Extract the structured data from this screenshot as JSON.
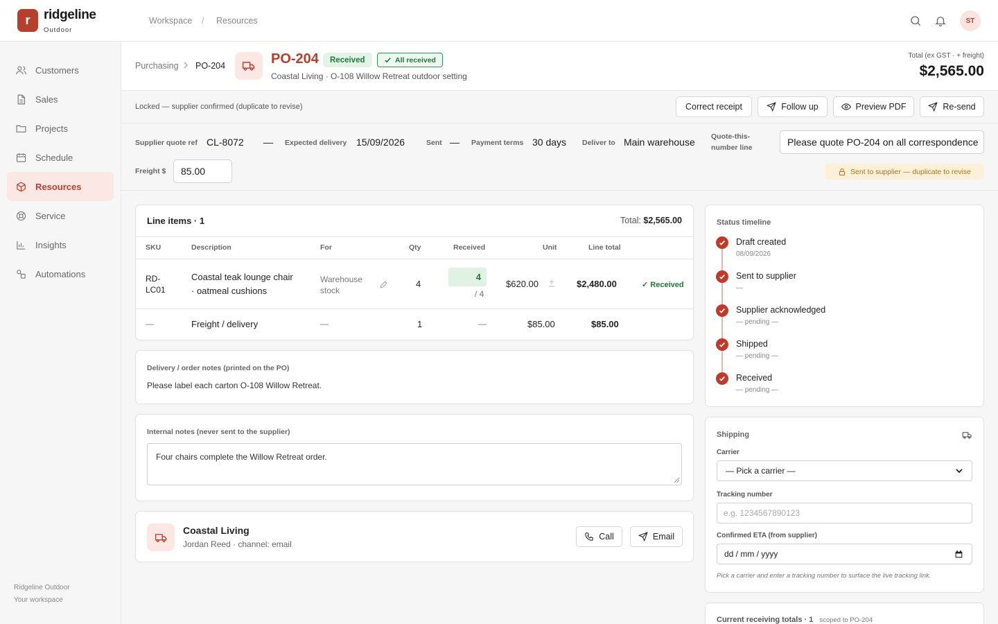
{
  "brand": {
    "initial": "r",
    "name": "ridgeline",
    "sub": "Outdoor"
  },
  "top_breadcrumb": {
    "workspace": "Workspace",
    "sep": "/",
    "resources": "Resources"
  },
  "user": {
    "initials": "ST"
  },
  "sidebar": {
    "items": [
      {
        "label": "Customers",
        "icon": "users-icon"
      },
      {
        "label": "Sales",
        "icon": "document-icon"
      },
      {
        "label": "Projects",
        "icon": "folder-icon"
      },
      {
        "label": "Schedule",
        "icon": "calendar-icon"
      },
      {
        "label": "Resources",
        "icon": "box-icon",
        "active": true
      },
      {
        "label": "Service",
        "icon": "lifebuoy-icon"
      },
      {
        "label": "Insights",
        "icon": "bar-chart-icon"
      },
      {
        "label": "Automations",
        "icon": "shapes-icon"
      }
    ],
    "footer": {
      "org": "Ridgeline Outdoor",
      "workspace": "Your workspace"
    }
  },
  "header": {
    "crumb_parent": "Purchasing",
    "crumb_current": "PO-204",
    "po_number": "PO-204",
    "status_badge": "Received",
    "received_badge": "All received",
    "subtitle": "Coastal Living · O-108 Willow Retreat outdoor setting",
    "total_label": "Total (ex GST · + freight)",
    "total_value": "$2,565.00"
  },
  "actions": {
    "locked_text": "Locked — supplier confirmed (duplicate to revise)",
    "correct_receipt": "Correct receipt",
    "follow_up": "Follow up",
    "preview_pdf": "Preview PDF",
    "resend": "Re-send"
  },
  "fields": {
    "supplier_quote_ref_label": "Supplier quote ref",
    "supplier_quote_ref": "CL-8072",
    "dash": "—",
    "expected_delivery_label": "Expected delivery",
    "expected_delivery": "15/09/2026",
    "sent_label": "Sent",
    "sent_value": "—",
    "payment_terms_label": "Payment terms",
    "payment_terms": "30 days",
    "deliver_to_label": "Deliver to",
    "deliver_to": "Main warehouse",
    "quote_line_label_1": "Quote-this-",
    "quote_line_label_2": "number line",
    "quote_line_value": "Please quote PO-204 on all correspondence",
    "freight_label": "Freight $",
    "freight_value": "85.00",
    "warning": "Sent to supplier — duplicate to revise"
  },
  "line_items": {
    "title": "Line items · 1",
    "total_label": "Total:",
    "total_value": "$2,565.00",
    "columns": {
      "sku": "SKU",
      "description": "Description",
      "for": "For",
      "qty": "Qty",
      "received": "Received",
      "unit": "Unit",
      "line_total": "Line total"
    },
    "rows": [
      {
        "sku_1": "RD-",
        "sku_2": "LC01",
        "desc_1": "Coastal teak lounge chair",
        "desc_2": "· oatmeal cushions",
        "for_1": "Warehouse",
        "for_2": "stock",
        "qty": "4",
        "received": "4",
        "received_of": "/ 4",
        "unit": "$620.00",
        "line_total": "$2,480.00",
        "status": "✓ Received"
      },
      {
        "sku": "—",
        "desc": "Freight / delivery",
        "for": "—",
        "qty": "1",
        "received": "—",
        "unit": "$85.00",
        "line_total": "$85.00"
      }
    ]
  },
  "delivery_notes": {
    "title": "Delivery / order notes (printed on the PO)",
    "text": "Please label each carton O-108 Willow Retreat."
  },
  "internal_notes": {
    "title": "Internal notes (never sent to the supplier)",
    "text": "Four chairs complete the Willow Retreat order."
  },
  "supplier": {
    "name": "Coastal Living",
    "contact": "Jordan Reed · channel: email",
    "call": "Call",
    "email": "Email"
  },
  "timeline": {
    "title": "Status timeline",
    "steps": [
      {
        "title": "Draft created",
        "sub": "08/09/2026"
      },
      {
        "title": "Sent to supplier",
        "sub": "—"
      },
      {
        "title": "Supplier acknowledged",
        "sub": "— pending —"
      },
      {
        "title": "Shipped",
        "sub": "— pending —"
      },
      {
        "title": "Received",
        "sub": "— pending —"
      }
    ]
  },
  "shipping": {
    "title": "Shipping",
    "carrier_label": "Carrier",
    "carrier_value": "— Pick a carrier —",
    "tracking_label": "Tracking number",
    "tracking_placeholder": "e.g. 1234567890123",
    "eta_label": "Confirmed ETA (from supplier)",
    "eta_placeholder": "dd / mm / yyyy",
    "hint": "Pick a carrier and enter a tracking number to surface the live tracking link."
  },
  "receiving": {
    "title": "Current receiving totals · 1",
    "scope": "scoped to PO-204"
  },
  "colors": {
    "accent": "#b5402e",
    "success": "#1f7a37",
    "warning": "#b0751b"
  }
}
